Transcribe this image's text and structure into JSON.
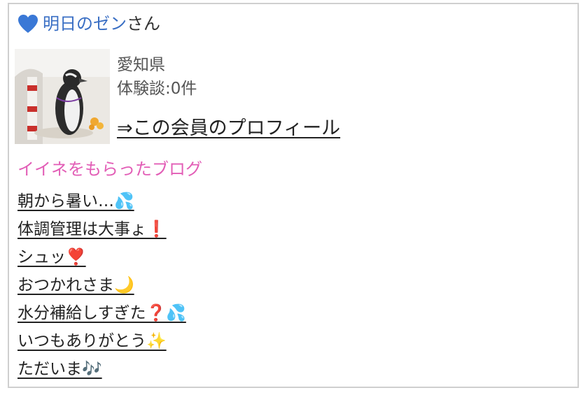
{
  "header": {
    "heart_color": "#3a78d6",
    "member_name": "明日のゼン",
    "suffix": "さん"
  },
  "profile": {
    "avatar_icon": "penguin-photo",
    "prefecture": "愛知県",
    "experience_count": "体験談:0件",
    "profile_link": "⇒この会員のプロフィール"
  },
  "likes_section": {
    "title": "イイネをもらったブログ",
    "title_color": "#e25db6",
    "posts": [
      {
        "title": "朝から暑い…💦"
      },
      {
        "title": "体調管理は大事ょ❗"
      },
      {
        "title": "シュッ❣️"
      },
      {
        "title": "おつかれさま🌙"
      },
      {
        "title": "水分補給しすぎた❓💦"
      },
      {
        "title": "いつもありがとう✨"
      },
      {
        "title": "ただいま🎶"
      }
    ]
  }
}
